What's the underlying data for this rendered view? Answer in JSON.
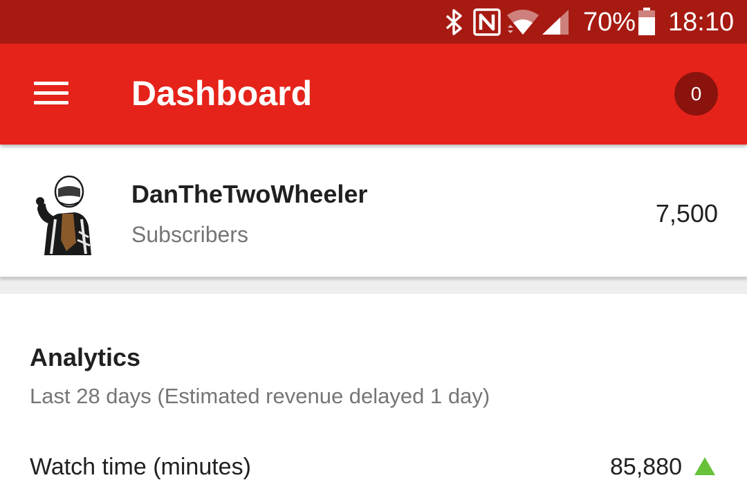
{
  "status_bar": {
    "icons": [
      "bluetooth-icon",
      "nfc-icon",
      "wifi-icon",
      "cell-signal-icon",
      "battery-icon"
    ],
    "battery": "70%",
    "time": "18:10"
  },
  "app_bar": {
    "menu_icon": "hamburger-menu-icon",
    "title": "Dashboard",
    "notification_count": "0"
  },
  "channel": {
    "avatar_icon": "channel-avatar",
    "name": "DanTheTwoWheeler",
    "subscribers_label": "Subscribers",
    "subscribers_count": "7,500"
  },
  "analytics": {
    "title": "Analytics",
    "subtitle": "Last 28 days (Estimated revenue delayed 1 day)",
    "metrics": [
      {
        "label": "Watch time (minutes)",
        "value": "85,880",
        "trend_icon": "trend-up-icon"
      }
    ]
  },
  "colors": {
    "status_bar": "#a61a12",
    "app_bar": "#e5231a",
    "badge": "#8a130d",
    "trend_up": "#67c23a"
  }
}
